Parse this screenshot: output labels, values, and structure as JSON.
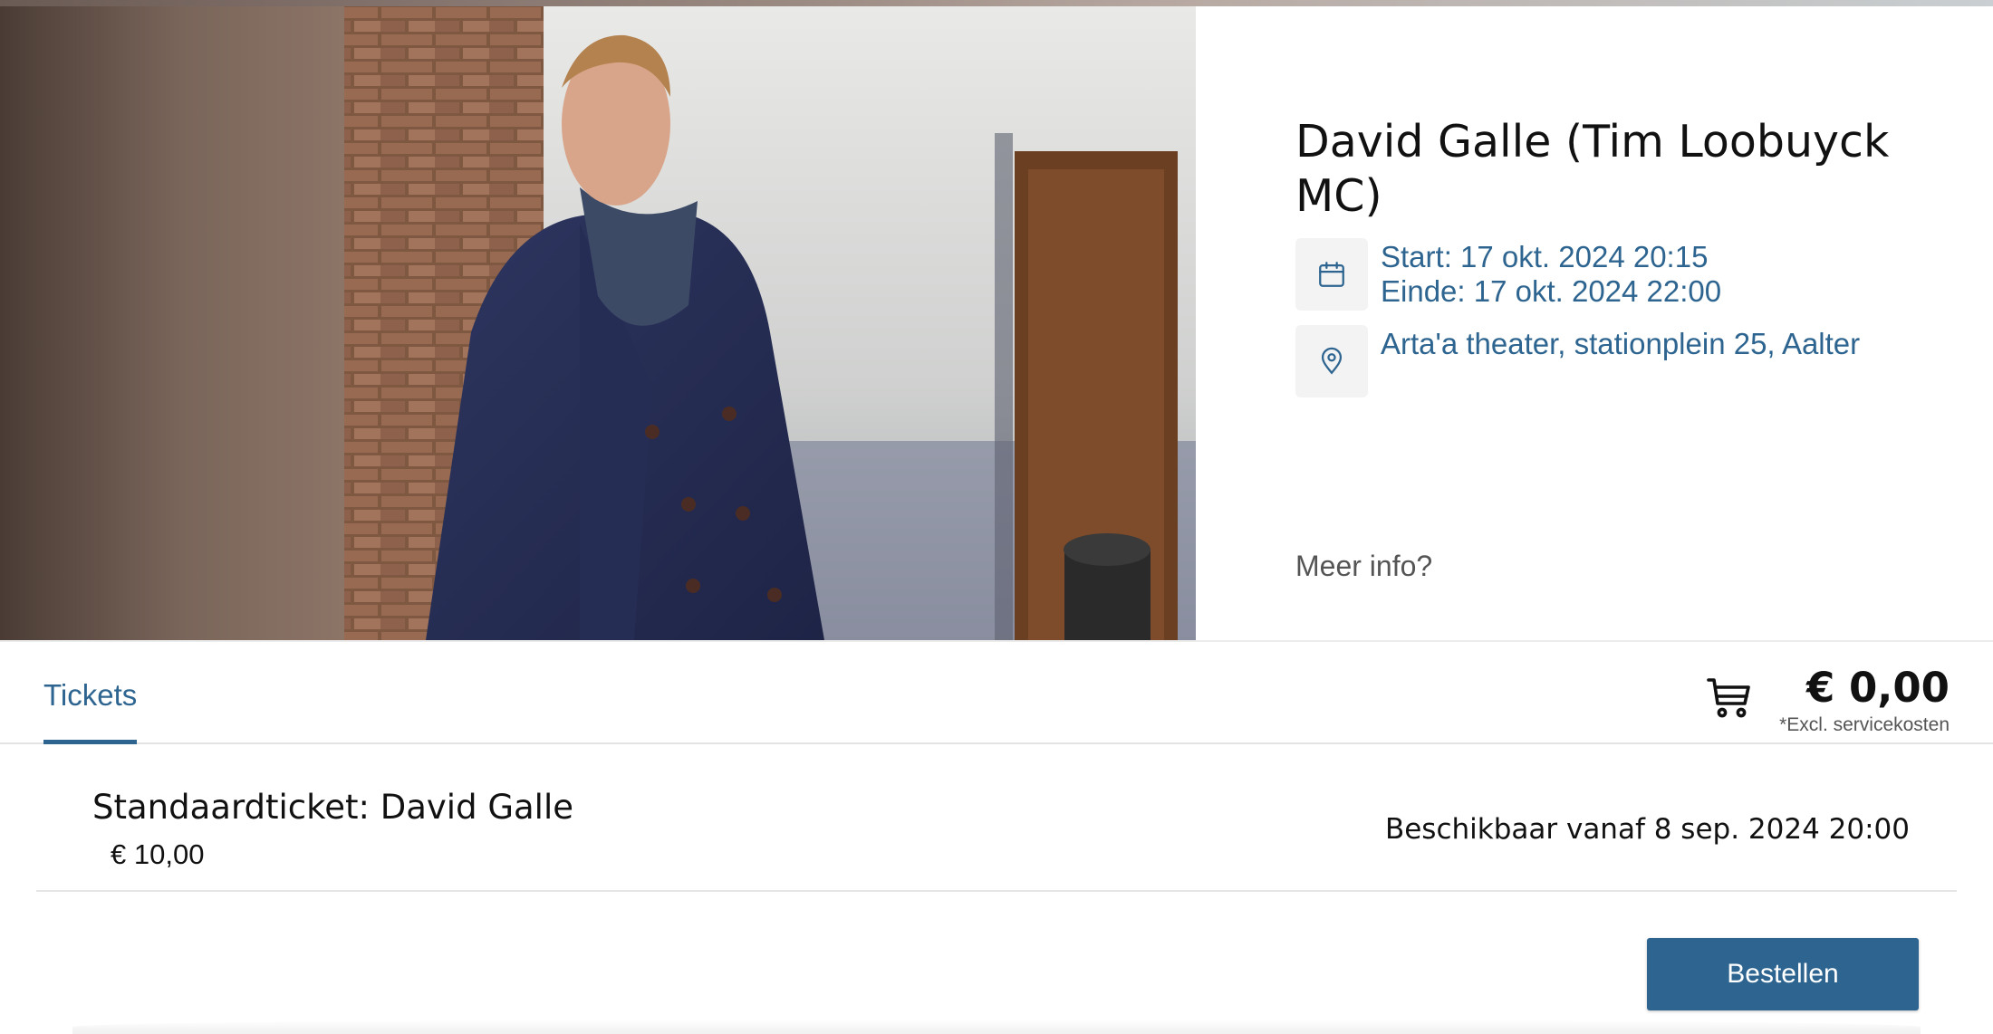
{
  "event": {
    "title": "David Galle (Tim Loobuyck MC)",
    "start": "Start: 17 okt. 2024 20:15",
    "end": "Einde: 17 okt. 2024 22:00",
    "location": "Arta'a theater, stationplein 25, Aalter",
    "more_info": "Meer info?"
  },
  "tabs": [
    {
      "label": "Tickets",
      "active": true
    }
  ],
  "cart": {
    "icon": "shopping-cart-icon",
    "total": "€ 0,00",
    "note": "*Excl. servicekosten"
  },
  "tickets": [
    {
      "name": "Standaardticket: David Galle",
      "price": "€ 10,00",
      "availability": "Beschikbaar vanaf 8 sep. 2024 20:00"
    }
  ],
  "actions": {
    "order_label": "Bestellen"
  },
  "colors": {
    "accent": "#2e6590",
    "icon_bg": "#f3f3f3"
  }
}
